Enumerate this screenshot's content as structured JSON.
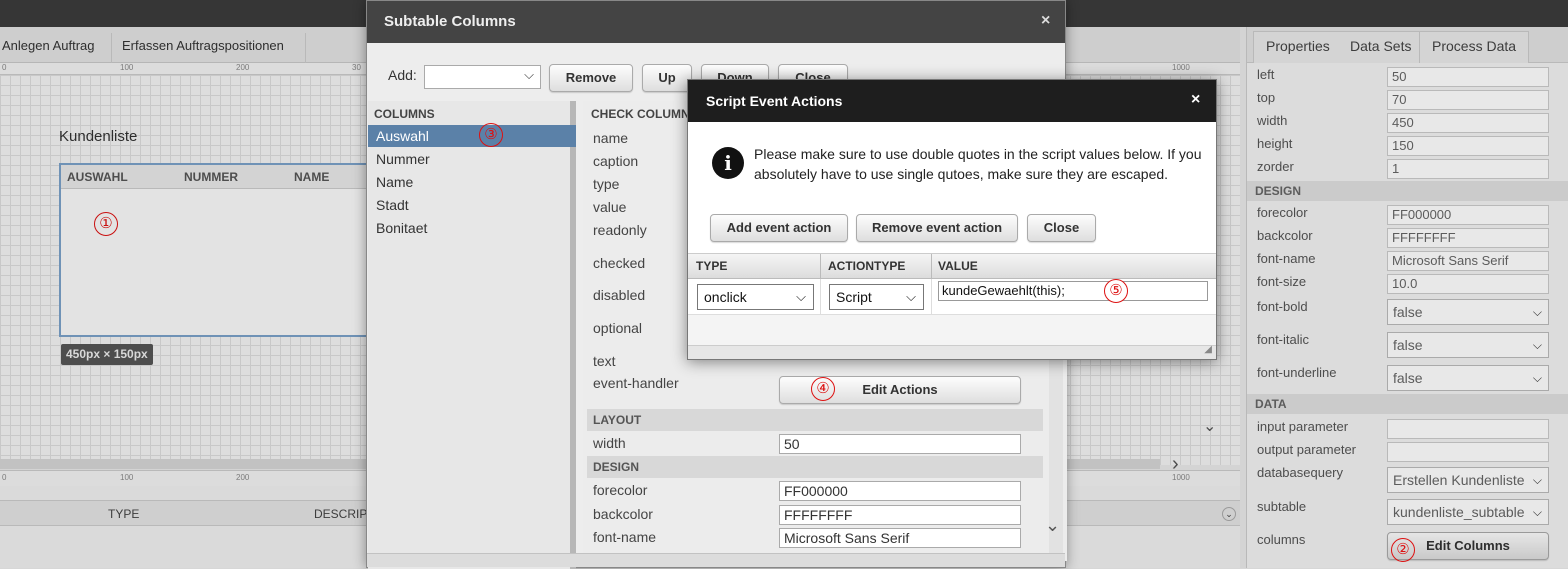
{
  "designer": {
    "tabs": [
      "Anlegen Auftrag",
      "Erfassen Auftragspositionen"
    ],
    "ruler_top": [
      "0",
      "100",
      "200",
      "30",
      "1000"
    ],
    "ruler_bottom": [
      "0",
      "100",
      "200",
      "1000"
    ],
    "component_title": "Kundenliste",
    "table_columns": [
      "AUSWAHL",
      "NUMMER",
      "NAME"
    ],
    "size_badge": "450px × 150px",
    "bottom_columns": [
      "TYPE",
      "DESCRIP"
    ]
  },
  "markers": [
    "①",
    "②",
    "③",
    "④",
    "⑤"
  ],
  "properties_panel": {
    "tabs": [
      "Properties",
      "Data Sets",
      "Process Data"
    ],
    "rows": [
      {
        "label": "left",
        "value": "50"
      },
      {
        "label": "top",
        "value": "70"
      },
      {
        "label": "width",
        "value": "450"
      },
      {
        "label": "height",
        "value": "150"
      },
      {
        "label": "zorder",
        "value": "1"
      }
    ],
    "design_section": "DESIGN",
    "design_rows": [
      {
        "label": "forecolor",
        "value": "FF000000"
      },
      {
        "label": "backcolor",
        "value": "FFFFFFFF"
      },
      {
        "label": "font-name",
        "value": "Microsoft Sans Serif"
      },
      {
        "label": "font-size",
        "value": "10.0"
      }
    ],
    "design_selects": [
      {
        "label": "font-bold",
        "value": "false"
      },
      {
        "label": "font-italic",
        "value": "false"
      },
      {
        "label": "font-underline",
        "value": "false"
      }
    ],
    "data_section": "DATA",
    "data_rows": [
      {
        "label": "input parameter",
        "value": ""
      },
      {
        "label": "output parameter",
        "value": ""
      }
    ],
    "data_selects": [
      {
        "label": "databasequery",
        "value": "Erstellen Kundenliste"
      },
      {
        "label": "subtable",
        "value": "kundenliste_subtable"
      }
    ],
    "columns_label": "columns",
    "edit_columns_button": "Edit Columns"
  },
  "subtable_dialog": {
    "title": "Subtable Columns",
    "close": "×",
    "add_label": "Add:",
    "buttons": [
      "Remove",
      "Up",
      "Down",
      "Close"
    ],
    "columns_header": "COLUMNS",
    "columns": [
      "Auswahl",
      "Nummer",
      "Name",
      "Stadt",
      "Bonitaet"
    ],
    "selected_column": "Auswahl",
    "check_header": "CHECK COLUMN",
    "props": [
      "name",
      "caption",
      "type",
      "value",
      "readonly",
      "checked",
      "disabled",
      "optional",
      "text",
      "event-handler"
    ],
    "edit_actions_button": "Edit Actions",
    "layout_section": "LAYOUT",
    "layout_rows": [
      {
        "label": "width",
        "value": "50"
      }
    ],
    "design_section": "DESIGN",
    "design_rows": [
      {
        "label": "forecolor",
        "value": "FF000000"
      },
      {
        "label": "backcolor",
        "value": "FFFFFFFF"
      },
      {
        "label": "font-name",
        "value": "Microsoft Sans Serif"
      }
    ]
  },
  "script_dialog": {
    "title": "Script Event Actions",
    "close": "×",
    "info_icon": "i",
    "message": "Please make sure to use double quotes in the script values below. If you absolutely have to use single qutoes, make sure they are escaped.",
    "buttons": [
      "Add event action",
      "Remove event action",
      "Close"
    ],
    "columns": [
      "TYPE",
      "ACTIONTYPE",
      "VALUE"
    ],
    "row": {
      "type": "onclick",
      "actiontype": "Script",
      "value": "kundeGewaehlt(this);"
    }
  },
  "colors": {
    "selected_row": "#5b81a8",
    "marker": "#dd1111",
    "title_bar": "#1e1e1e"
  }
}
